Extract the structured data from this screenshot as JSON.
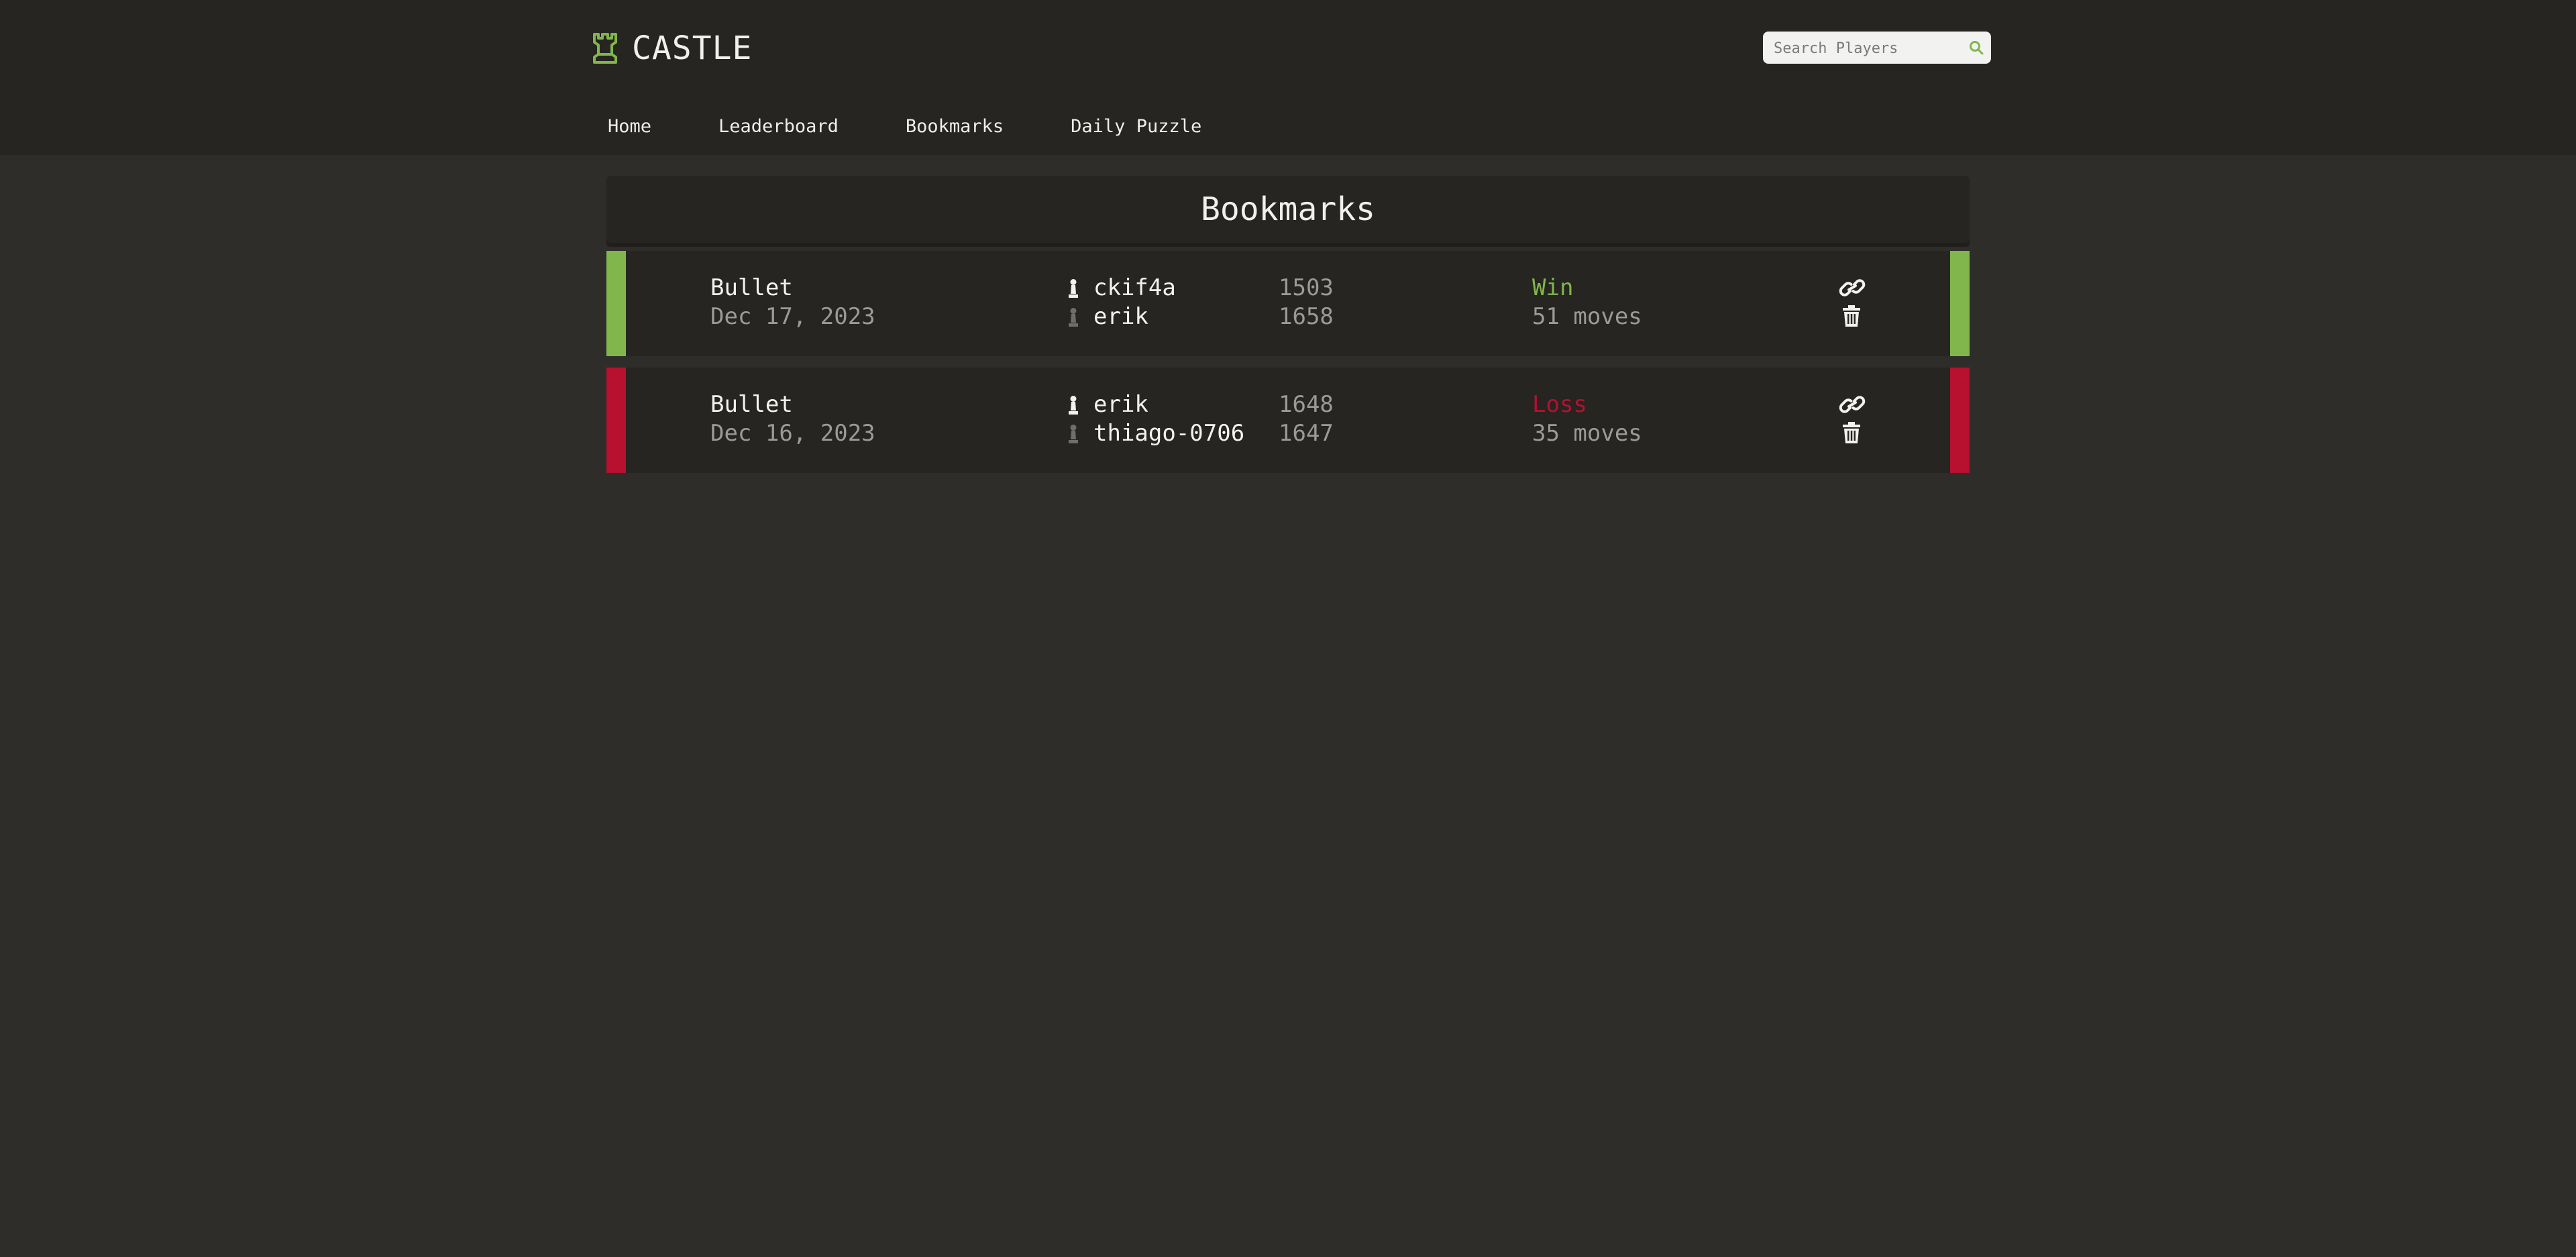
{
  "brand": {
    "name": "CASTLE",
    "logo_icon": "rook-icon",
    "accent": "#81b64c"
  },
  "search": {
    "placeholder": "Search Players",
    "value": "",
    "icon": "search-icon"
  },
  "nav": {
    "items": [
      {
        "label": "Home"
      },
      {
        "label": "Leaderboard"
      },
      {
        "label": "Bookmarks"
      },
      {
        "label": "Daily Puzzle"
      }
    ]
  },
  "page": {
    "title": "Bookmarks"
  },
  "colors": {
    "win": "#81b64c",
    "loss": "#b8102f",
    "white_pawn": "#f4f2ee",
    "black_pawn": "#6f6e6a"
  },
  "games": [
    {
      "mode": "Bullet",
      "date": "Dec 17, 2023",
      "white_player": "ckif4a",
      "white_rating": "1503",
      "black_player": "erik",
      "black_rating": "1658",
      "result": "Win",
      "outcome": "win",
      "moves": "51 moves",
      "link_icon": "link-icon",
      "delete_icon": "trash-icon"
    },
    {
      "mode": "Bullet",
      "date": "Dec 16, 2023",
      "white_player": "erik",
      "white_rating": "1648",
      "black_player": "thiago-0706",
      "black_rating": "1647",
      "result": "Loss",
      "outcome": "loss",
      "moves": "35 moves",
      "link_icon": "link-icon",
      "delete_icon": "trash-icon"
    }
  ]
}
